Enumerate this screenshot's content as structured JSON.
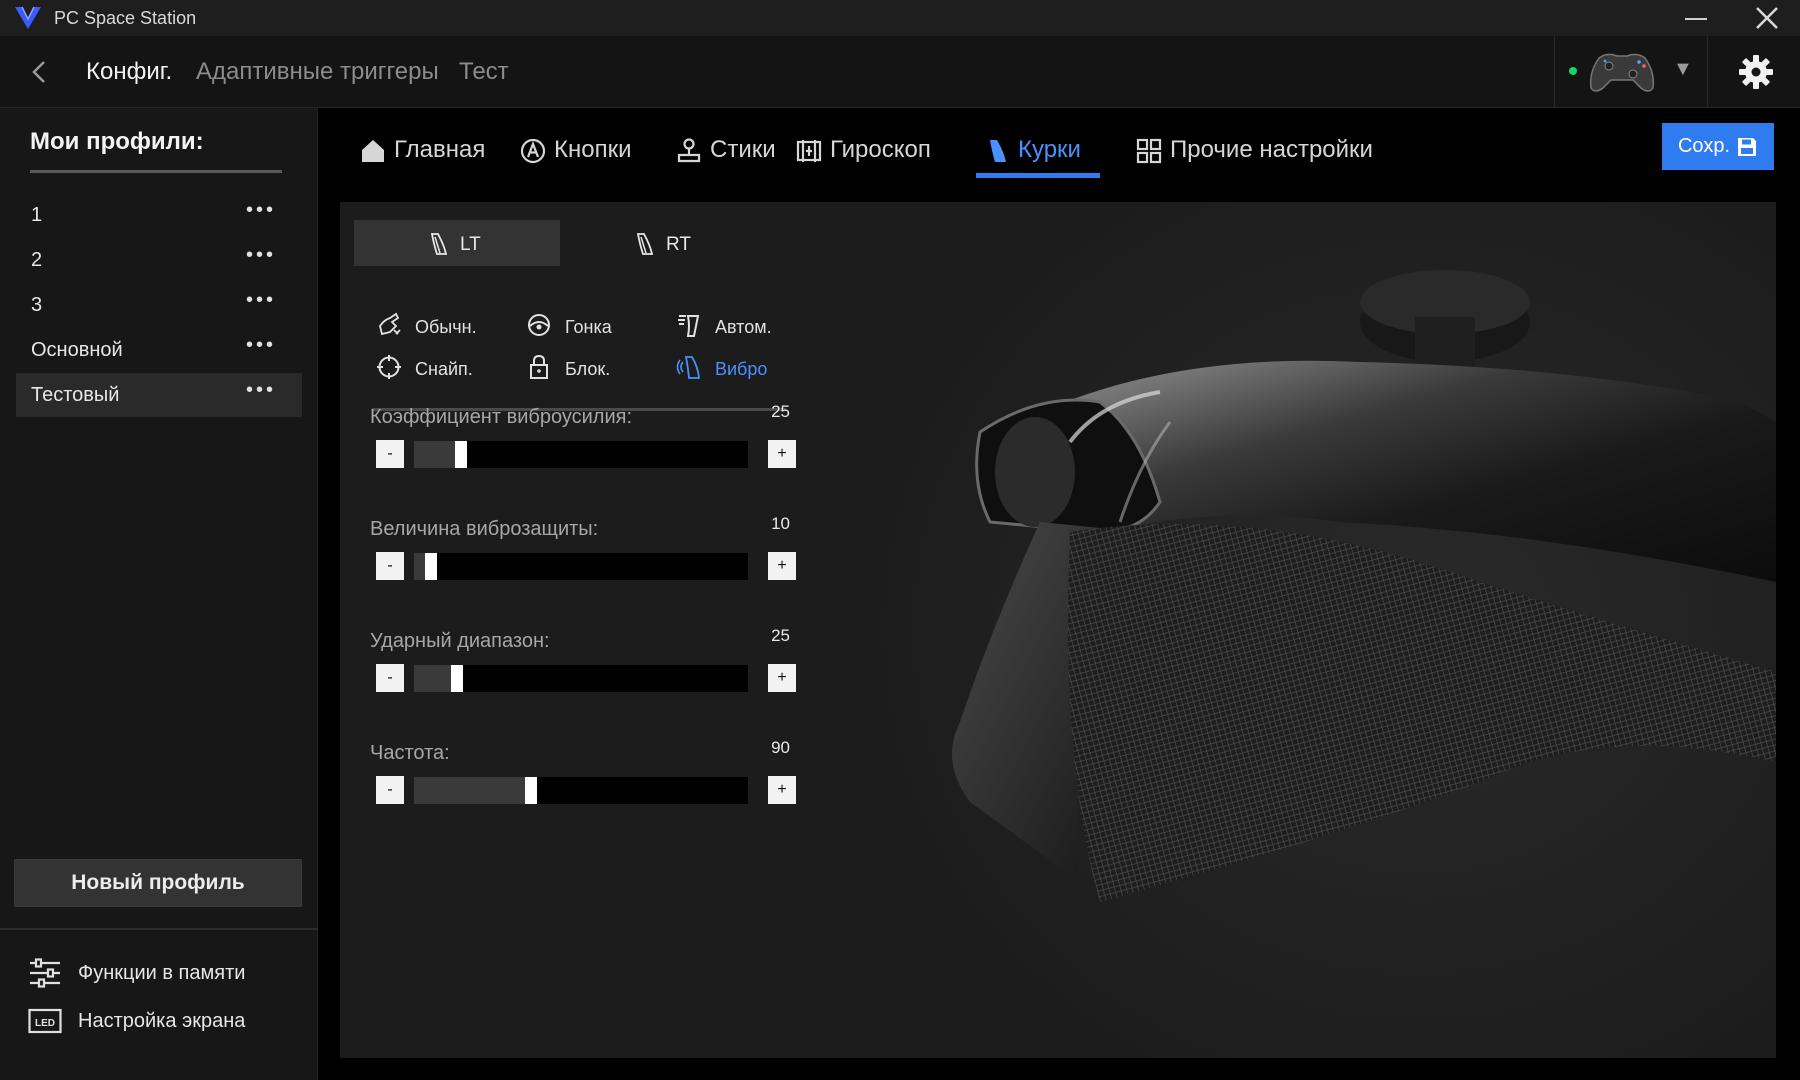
{
  "app": {
    "title": "PC Space Station"
  },
  "topnav": {
    "tabs": [
      {
        "label": "Конфиг."
      },
      {
        "label": "Адаптивные триггеры"
      },
      {
        "label": "Тест"
      }
    ],
    "dropdown_glyph": "▼"
  },
  "sidebar": {
    "title": "Мои профили:",
    "profiles": [
      {
        "name": "1"
      },
      {
        "name": "2"
      },
      {
        "name": "3"
      },
      {
        "name": "Основной"
      },
      {
        "name": "Тестовый",
        "active": true
      }
    ],
    "more_glyph": "•••",
    "new_profile_label": "Новый профиль",
    "links": [
      {
        "label": "Функции в памяти",
        "icon": "sliders-icon"
      },
      {
        "label": "Настройка экрана",
        "icon": "led-icon"
      }
    ]
  },
  "main": {
    "tabs": [
      {
        "label": "Главная",
        "icon": "home-icon"
      },
      {
        "label": "Кнопки",
        "icon": "button-a-icon"
      },
      {
        "label": "Стики",
        "icon": "joystick-icon"
      },
      {
        "label": "Гироскоп",
        "icon": "gyro-icon"
      },
      {
        "label": "Курки",
        "icon": "trigger-icon",
        "active": true
      },
      {
        "label": "Прочие настройки",
        "icon": "grid-icon"
      }
    ],
    "save_label": "Сохр."
  },
  "triggers": {
    "tabs": [
      {
        "label": "LT",
        "active": true
      },
      {
        "label": "RT"
      }
    ],
    "modes": [
      {
        "label": "Обычн.",
        "icon": "normal-mode-icon"
      },
      {
        "label": "Гонка",
        "icon": "racing-icon"
      },
      {
        "label": "Автом.",
        "icon": "auto-icon"
      },
      {
        "label": "Снайп.",
        "icon": "crosshair-icon"
      },
      {
        "label": "Блок.",
        "icon": "lock-icon"
      },
      {
        "label": "Вибро",
        "icon": "vibration-icon",
        "active": true
      }
    ],
    "sliders": [
      {
        "label": "Коэффициент виброусилия:",
        "value": "25",
        "position": 0.14
      },
      {
        "label": "Величина виброзащиты:",
        "value": "10",
        "position": 0.05
      },
      {
        "label": "Ударный диапазон:",
        "value": "25",
        "position": 0.13
      },
      {
        "label": "Частота:",
        "value": "90",
        "position": 0.35
      }
    ],
    "minus_label": "-",
    "plus_label": "+"
  },
  "colors": {
    "accent": "#2f7cf0",
    "status_connected": "#19d36b"
  }
}
